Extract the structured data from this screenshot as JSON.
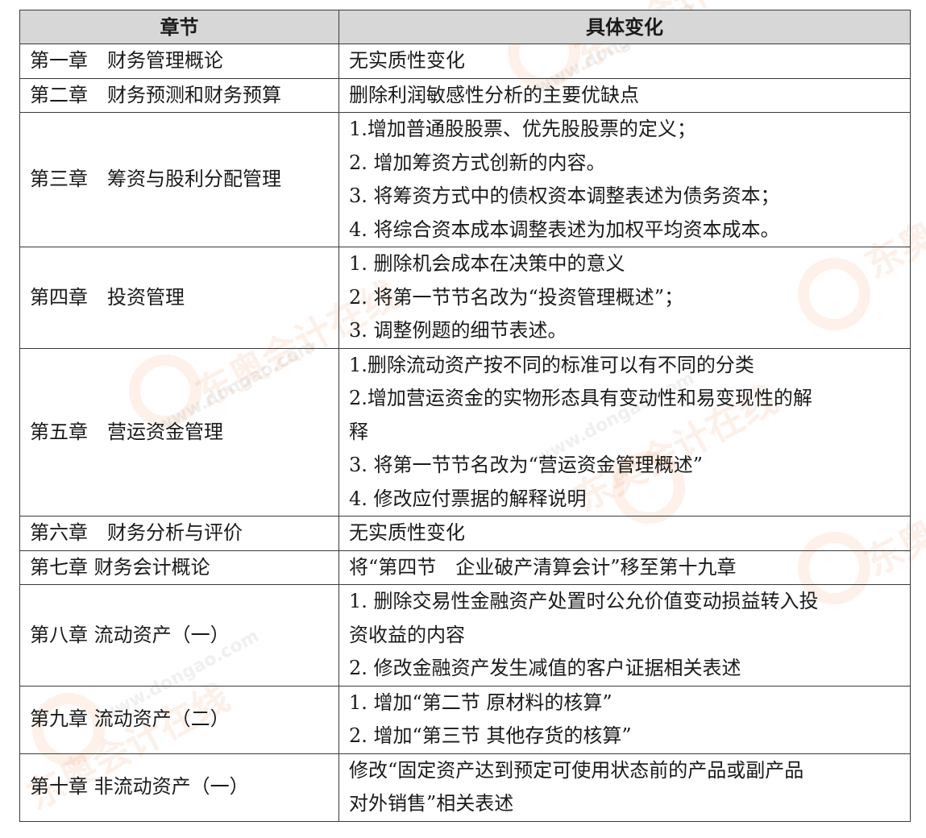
{
  "table": {
    "headers": [
      "章节",
      "具体变化"
    ],
    "rows": [
      {
        "chapter": "第一章　财务管理概论",
        "changes": [
          "无实质性变化"
        ]
      },
      {
        "chapter": "第二章　财务预测和财务预算",
        "changes": [
          "删除利润敏感性分析的主要优缺点"
        ]
      },
      {
        "chapter": "第三章　筹资与股利分配管理",
        "changes": [
          "1.增加普通股股票、优先股股票的定义；",
          "2. 增加筹资方式创新的内容。",
          "3. 将筹资方式中的债权资本调整表述为债务资本；",
          "4. 将综合资本成本调整表述为加权平均资本成本。"
        ]
      },
      {
        "chapter": "第四章　投资管理",
        "changes": [
          "1. 删除机会成本在决策中的意义",
          "2. 将第一节节名改为“投资管理概述”；",
          "3. 调整例题的细节表述。"
        ]
      },
      {
        "chapter": "第五章　营运资金管理",
        "changes": [
          "1.删除流动资产按不同的标准可以有不同的分类",
          "2.增加营运资金的实物形态具有变动性和易变现性的解",
          "释",
          "3. 将第一节节名改为“营运资金管理概述”",
          "4. 修改应付票据的解释说明"
        ]
      },
      {
        "chapter": "第六章　财务分析与评价",
        "changes": [
          "无实质性变化"
        ]
      },
      {
        "chapter": "第七章 财务会计概论",
        "changes": [
          "将“第四节　企业破产清算会计”移至第十九章"
        ]
      },
      {
        "chapter": "第八章 流动资产（一）",
        "changes": [
          "1. 删除交易性金融资产处置时公允价值变动损益转入投",
          "资收益的内容",
          "2. 修改金融资产发生减值的客户证据相关表述"
        ]
      },
      {
        "chapter": "第九章 流动资产（二）",
        "changes": [
          "1. 增加“第二节 原材料的核算”",
          "2. 增加“第三节 其他存货的核算”"
        ]
      },
      {
        "chapter": "第十章 非流动资产（一）",
        "changes": [
          "修改“固定资产达到预定可使用状态前的产品或副产品",
          "对外销售”相关表述"
        ]
      }
    ]
  },
  "watermark": {
    "brand": "东奥会计在线",
    "url": "www.dongao.com",
    "color": "#e68246"
  }
}
